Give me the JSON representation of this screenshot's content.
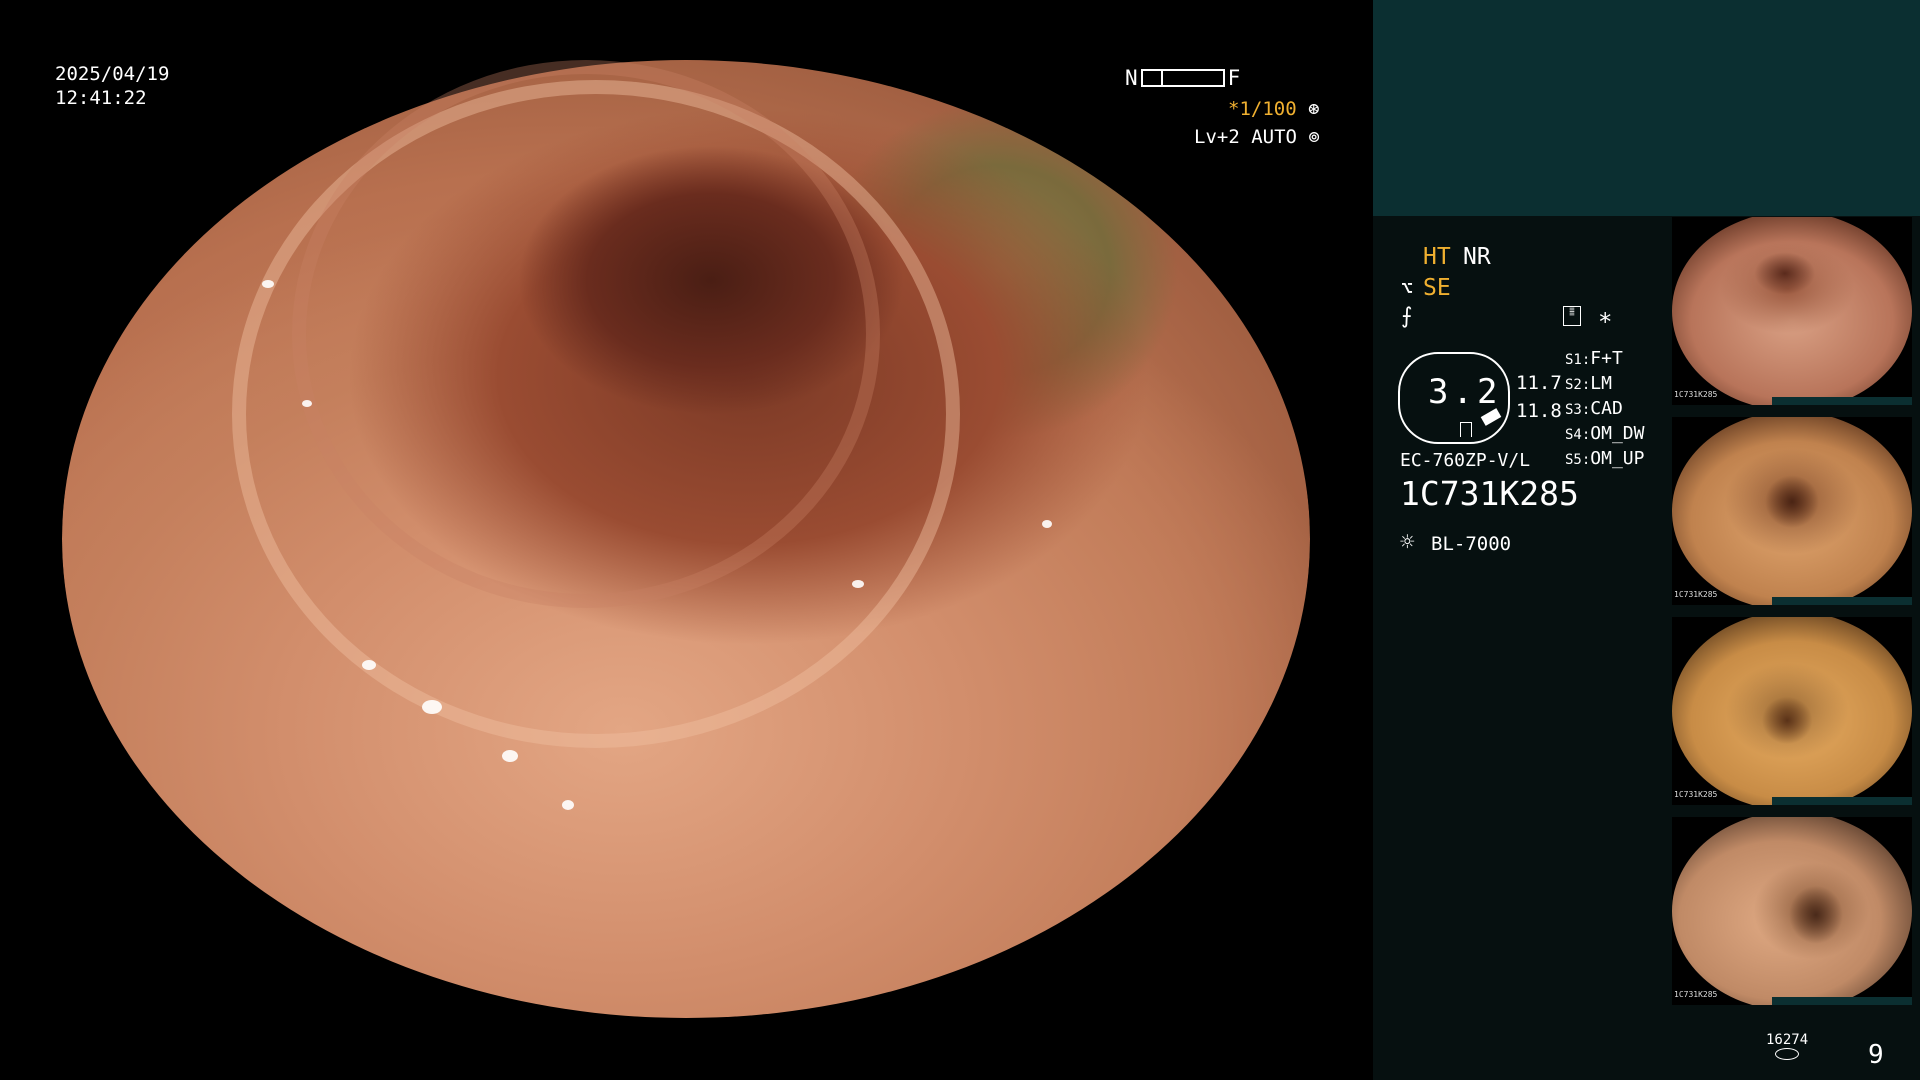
{
  "overlay": {
    "date": "2025/04/19",
    "time": "12:41:22",
    "near_label": "N",
    "far_label": "F",
    "shutter": "*1/100",
    "level": "Lv+2 AUTO"
  },
  "side_panel": {
    "mode_ht": "HT",
    "mode_nr": "NR",
    "mode_se": "SE",
    "asterisk": "*",
    "dial_value": "3.2",
    "val_a": "11.7",
    "val_b": "11.8",
    "scope_model": "EC-760ZP-V/L",
    "serial": "1C731K285",
    "light_source": "BL-7000",
    "presets": [
      {
        "key": "S1:",
        "value": "F+T"
      },
      {
        "key": "S2:",
        "value": "LM"
      },
      {
        "key": "S3:",
        "value": "CAD"
      },
      {
        "key": "S4:",
        "value": "OM_DW"
      },
      {
        "key": "S5:",
        "value": "OM_UP"
      }
    ],
    "image_count": "16274",
    "page_number": "9",
    "thumbnail_label": "1C731K285"
  },
  "colors": {
    "accent_orange": "#f0b030",
    "panel_teal": "#0b2f31",
    "panel_dark": "#061010"
  }
}
